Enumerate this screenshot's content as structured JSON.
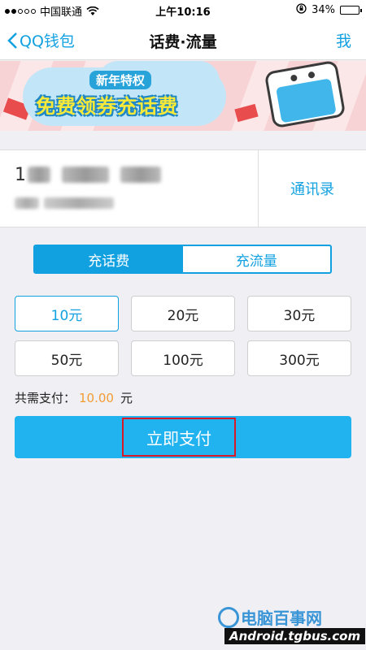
{
  "status_bar": {
    "carrier": "中国联通",
    "time": "上午10:16",
    "battery": "34%",
    "battery_level": 0.34
  },
  "nav": {
    "back_label": "QQ钱包",
    "title": "话费·流量",
    "right_label": "我"
  },
  "banner": {
    "subtitle": "新年特权",
    "headline": "免费领券充话费"
  },
  "phone": {
    "number_prefix": "1",
    "contacts_label": "通讯录"
  },
  "tabs": [
    {
      "label": "充话费",
      "active": true
    },
    {
      "label": "充流量",
      "active": false
    }
  ],
  "amounts": [
    {
      "label": "10元",
      "selected": true
    },
    {
      "label": "20元",
      "selected": false
    },
    {
      "label": "30元",
      "selected": false
    },
    {
      "label": "50元",
      "selected": false
    },
    {
      "label": "100元",
      "selected": false
    },
    {
      "label": "300元",
      "selected": false
    }
  ],
  "total": {
    "label": "共需支付：",
    "value": "10.00",
    "unit": "元"
  },
  "pay_button": {
    "label": "立即支付"
  },
  "watermark": {
    "site_name": "电脑百事网",
    "url": "Android.tgbus.com"
  },
  "colors": {
    "accent": "#12a1e0",
    "pay_button": "#21b3ef",
    "price": "#f39c33",
    "highlight_box": "#d9192a"
  }
}
